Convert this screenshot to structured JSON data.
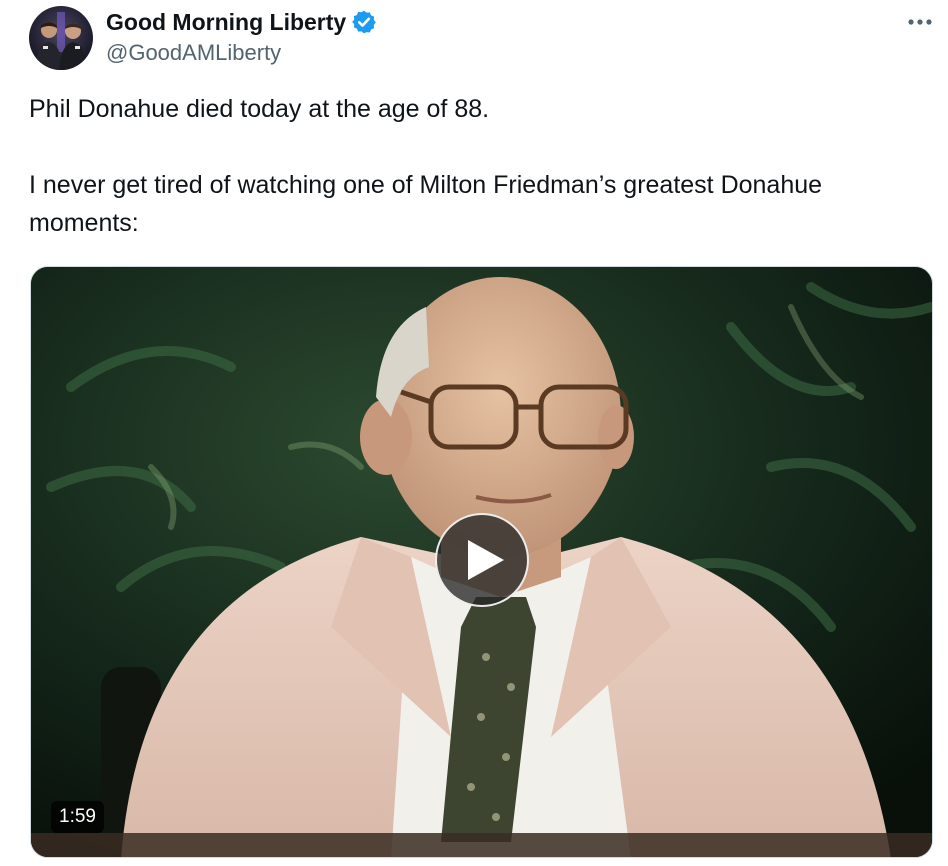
{
  "tweet": {
    "author": {
      "display_name": "Good Morning Liberty",
      "handle": "@GoodAMLiberty",
      "verified": true,
      "verified_color": "#1d9bf0"
    },
    "text_paragraphs": [
      "Phil Donahue died today at the age of 88.",
      "I never get tired of watching one of Milton Friedman’s greatest Donahue moments:"
    ],
    "media": {
      "type": "video",
      "duration": "1:59"
    }
  },
  "icons": {
    "avatar": "avatar-image",
    "verified": "verified-badge-icon",
    "more": "more-options-icon",
    "play": "play-icon"
  },
  "colors": {
    "text": "#0f1419",
    "secondary_text": "#536471",
    "accent": "#1d9bf0"
  }
}
